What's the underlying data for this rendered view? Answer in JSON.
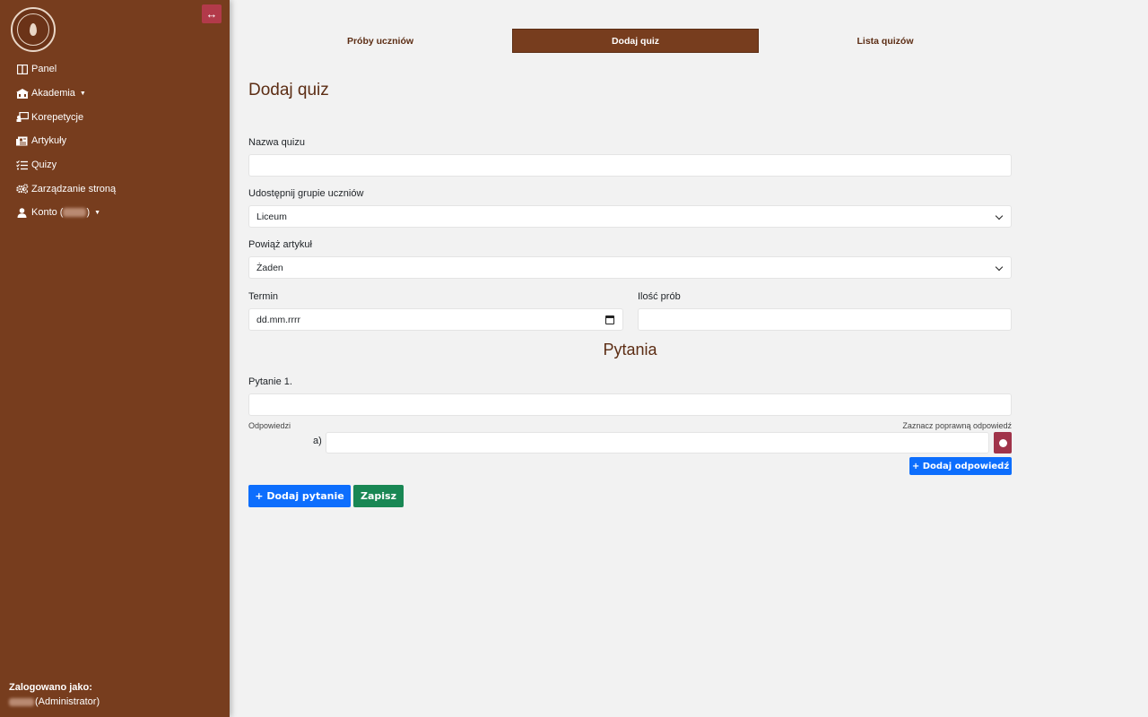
{
  "sidebar": {
    "toggle_icon": "↔",
    "items": [
      {
        "label": "Panel",
        "icon": "columns-icon",
        "dropdown": false
      },
      {
        "label": "Akademia",
        "icon": "building-icon",
        "dropdown": true
      },
      {
        "label": "Korepetycje",
        "icon": "chalkboard-icon",
        "dropdown": false
      },
      {
        "label": "Artykuły",
        "icon": "newspaper-icon",
        "dropdown": false
      },
      {
        "label": "Quizy",
        "icon": "list-check-icon",
        "dropdown": false
      },
      {
        "label": "Zarządzanie stroną",
        "icon": "cogs-icon",
        "dropdown": false
      },
      {
        "label": "Konto (",
        "label_end": ")",
        "icon": "user-icon",
        "dropdown": true
      }
    ],
    "logged_in_label": "Zalogowano jako:",
    "logged_in_role": "(Administrator)"
  },
  "tabs": [
    "Próby uczniów",
    "Dodaj quiz",
    "Lista quizów"
  ],
  "active_tab": "Dodaj quiz",
  "form": {
    "title": "Dodaj quiz",
    "quiz_name_label": "Nazwa quizu",
    "quiz_name_value": "",
    "group_label": "Udostępnij grupie uczniów",
    "group_value": "Liceum",
    "article_label": "Powiąż artykuł",
    "article_value": "Żaden",
    "deadline_label": "Termin",
    "deadline_placeholder": "dd.mm.rrrr",
    "attempts_label": "Ilość prób",
    "attempts_value": ""
  },
  "questions": {
    "section_title": "Pytania",
    "question_label": "Pytanie 1.",
    "answers_label": "Odpowiedzi",
    "correct_label": "Zaznacz poprawną odpowiedź",
    "answer_prefix": "a)",
    "add_answer": "+ Dodaj odpowiedź"
  },
  "buttons": {
    "add_question": "+ Dodaj pytanie",
    "save": "Zapisz"
  },
  "colors": {
    "sidebar_bg": "#773d1e",
    "accent_red": "#b23a4a",
    "primary_blue": "#0d6efd",
    "success_green": "#198754"
  }
}
